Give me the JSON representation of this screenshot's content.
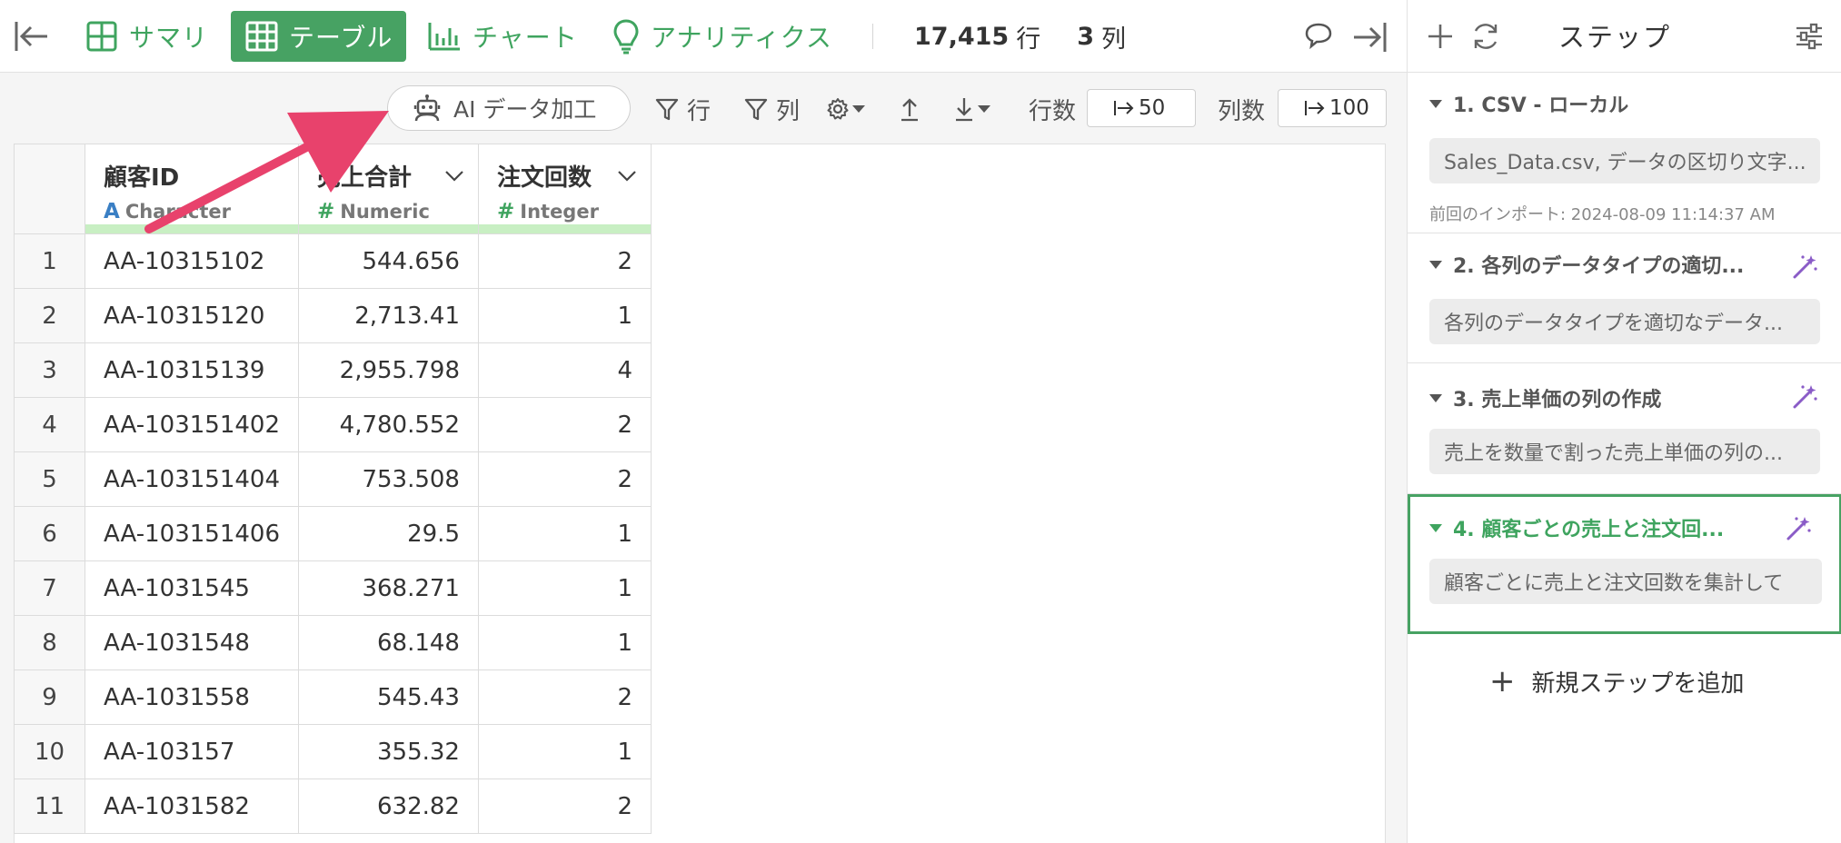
{
  "topbar": {
    "tabs": [
      {
        "label": "サマリ",
        "icon": "summary-grid-icon"
      },
      {
        "label": "テーブル",
        "icon": "table-icon",
        "active": true
      },
      {
        "label": "チャート",
        "icon": "bar-chart-icon"
      },
      {
        "label": "アナリティクス",
        "icon": "lightbulb-icon"
      }
    ],
    "row_count": "17,415",
    "row_unit": "行",
    "col_count": "3",
    "col_unit": "列"
  },
  "toolbar": {
    "ai_label": "AI データ加工",
    "filter_row": "行",
    "filter_col": "列",
    "rows_label": "行数",
    "rows_value": "50",
    "cols_label": "列数",
    "cols_value": "100"
  },
  "table": {
    "columns": [
      {
        "name": "顧客ID",
        "type_icon": "A",
        "type": "Character"
      },
      {
        "name": "売上合計",
        "type_icon": "#",
        "type": "Numeric"
      },
      {
        "name": "注文回数",
        "type_icon": "#",
        "type": "Integer"
      }
    ],
    "rows": [
      {
        "n": "1",
        "id": "AA-10315102",
        "sales": "544.656",
        "count": "2"
      },
      {
        "n": "2",
        "id": "AA-10315120",
        "sales": "2,713.41",
        "count": "1"
      },
      {
        "n": "3",
        "id": "AA-10315139",
        "sales": "2,955.798",
        "count": "4"
      },
      {
        "n": "4",
        "id": "AA-103151402",
        "sales": "4,780.552",
        "count": "2"
      },
      {
        "n": "5",
        "id": "AA-103151404",
        "sales": "753.508",
        "count": "2"
      },
      {
        "n": "6",
        "id": "AA-103151406",
        "sales": "29.5",
        "count": "1"
      },
      {
        "n": "7",
        "id": "AA-1031545",
        "sales": "368.271",
        "count": "1"
      },
      {
        "n": "8",
        "id": "AA-1031548",
        "sales": "68.148",
        "count": "1"
      },
      {
        "n": "9",
        "id": "AA-1031558",
        "sales": "545.43",
        "count": "2"
      },
      {
        "n": "10",
        "id": "AA-103157",
        "sales": "355.32",
        "count": "1"
      },
      {
        "n": "11",
        "id": "AA-1031582",
        "sales": "632.82",
        "count": "2"
      }
    ]
  },
  "panel": {
    "title": "ステップ",
    "steps": [
      {
        "title": "1. CSV - ローカル",
        "desc": "Sales_Data.csv, データの区切り文字...",
        "meta": "前回のインポート: 2024-08-09 11:14:37 AM",
        "ai": false
      },
      {
        "title": "2. 各列のデータタイプの適切...",
        "desc": "各列のデータタイプを適切なデータ...",
        "ai": true
      },
      {
        "title": "3. 売上単価の列の作成",
        "desc": "売上を数量で割った売上単価の列の...",
        "ai": true
      },
      {
        "title": "4. 顧客ごとの売上と注文回...",
        "desc": "顧客ごとに売上と注文回数を集計して",
        "ai": true,
        "active": true
      }
    ],
    "add_step": "新規ステップを追加"
  },
  "colors": {
    "accent": "#47a263",
    "arrow": "#e8426c",
    "ai_wand": "#8a5cc7"
  }
}
